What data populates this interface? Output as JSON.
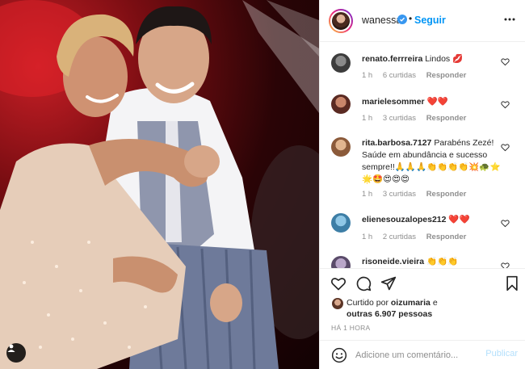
{
  "post": {
    "username": "wanessa",
    "follow_label": "Seguir",
    "dot": "•",
    "time_ago": "HÁ 1 HORA"
  },
  "comments": [
    {
      "user": "renato.ferrreira",
      "text": "Lindos 💋",
      "time": "1 h",
      "likes": "6 curtidas",
      "reply": "Responder"
    },
    {
      "user": "marielesommer",
      "text": "❤️❤️",
      "time": "1 h",
      "likes": "3 curtidas",
      "reply": "Responder"
    },
    {
      "user": "rita.barbosa.7127",
      "text": "Parabéns Zezé! Saúde em abundância e sucesso sempre!!🙏🙏🙏👏👏👏👏💥🐢⭐🌟🤩😍😍😍",
      "time": "1 h",
      "likes": "3 curtidas",
      "reply": "Responder"
    },
    {
      "user": "elienesouzalopes212",
      "text": "❤️❤️",
      "time": "1 h",
      "likes": "2 curtidas",
      "reply": "Responder"
    },
    {
      "user": "risoneide.vieira",
      "text": "👏👏👏",
      "time": "",
      "likes": "",
      "reply": ""
    }
  ],
  "likes": {
    "prefix": "Curtido por",
    "user": "oizumaria",
    "and": "e",
    "others": "outras 6.907 pessoas"
  },
  "composer": {
    "placeholder": "Adicione um comentário...",
    "publish_label": "Publicar"
  },
  "icons": {
    "more": "more-horizontal-icon",
    "like": "heart-icon",
    "comment": "comment-bubble-icon",
    "share": "paper-plane-icon",
    "save": "bookmark-icon",
    "emoji": "emoji-smile-icon",
    "tags": "user-tag-icon",
    "verified": "verified-badge-icon"
  },
  "colors": {
    "accent_blue": "#0095f6",
    "verified_blue": "#3897f0",
    "muted": "#8e8e8e",
    "publish_disabled": "#b2dffc"
  }
}
